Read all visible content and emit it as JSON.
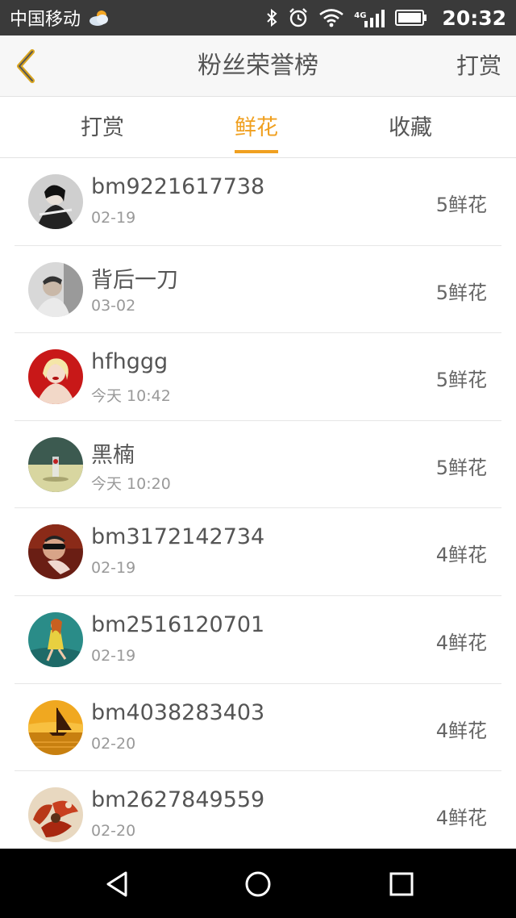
{
  "status_bar": {
    "carrier": "中国移动",
    "network": "4G",
    "time": "20:32"
  },
  "header": {
    "title": "粉丝荣誉榜",
    "action_label": "打赏"
  },
  "tabs": [
    {
      "label": "打赏",
      "active": false
    },
    {
      "label": "鲜花",
      "active": true
    },
    {
      "label": "收藏",
      "active": false
    }
  ],
  "fans": [
    {
      "name": "bm9221617738",
      "date": "02-19",
      "amount": "5鲜花"
    },
    {
      "name": "背后一刀",
      "date": "03-02",
      "amount": "5鲜花"
    },
    {
      "name": "hfhggg",
      "date": "今天 10:42",
      "amount": "5鲜花"
    },
    {
      "name": "黑楠",
      "date": "今天 10:20",
      "amount": "5鲜花"
    },
    {
      "name": "bm3172142734",
      "date": "02-19",
      "amount": "4鲜花"
    },
    {
      "name": "bm2516120701",
      "date": "02-19",
      "amount": "4鲜花"
    },
    {
      "name": "bm4038283403",
      "date": "02-20",
      "amount": "4鲜花"
    },
    {
      "name": "bm2627849559",
      "date": "02-20",
      "amount": "4鲜花"
    }
  ],
  "colors": {
    "accent": "#f0a020",
    "status_bar": "#3a3a3a",
    "header_bg": "#f7f7f7",
    "nav_bar": "#000000"
  },
  "icons": {
    "back": "chevron-left-icon",
    "weather": "cloudy-sun-icon",
    "bluetooth": "bluetooth-icon",
    "alarm": "alarm-icon",
    "wifi": "wifi-icon",
    "signal": "signal-icon",
    "battery": "battery-icon",
    "nav_back": "nav-back-icon",
    "nav_home": "nav-home-icon",
    "nav_recent": "nav-recent-icon"
  }
}
